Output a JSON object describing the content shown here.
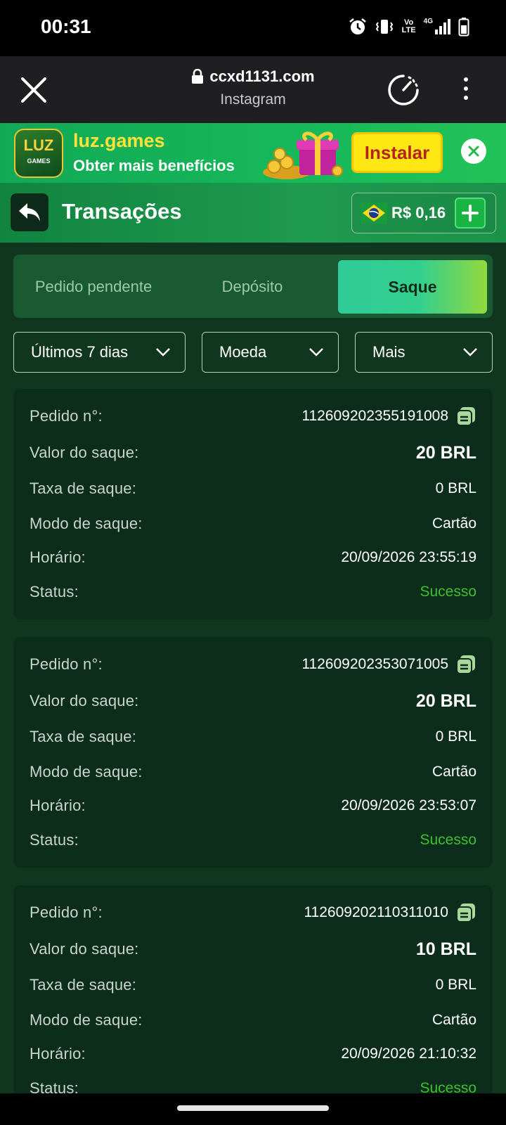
{
  "status_bar": {
    "time": "00:31",
    "network": "4G",
    "volte": "Vo LTE"
  },
  "browser": {
    "url": "ccxd1131.com",
    "source": "Instagram"
  },
  "ad": {
    "title": "luz.games",
    "subtitle": "Obter mais benefícios",
    "install_label": "Instalar",
    "logo_text": "LUZ",
    "logo_sub": "GAMES"
  },
  "header": {
    "title": "Transações",
    "balance": "R$ 0,16"
  },
  "tabs": [
    {
      "label": "Pedido pendente",
      "active": false
    },
    {
      "label": "Depósito",
      "active": false
    },
    {
      "label": "Saque",
      "active": true
    }
  ],
  "filters": [
    {
      "label": "Últimos 7 dias"
    },
    {
      "label": "Moeda"
    },
    {
      "label": "Mais"
    }
  ],
  "labels": {
    "order": "Pedido n°:",
    "amount": "Valor do saque:",
    "fee": "Taxa de saque:",
    "mode": "Modo de saque:",
    "time": "Horário:",
    "status": "Status:"
  },
  "transactions": [
    {
      "order_no": "112609202355191008",
      "amount": "20 BRL",
      "fee": "0 BRL",
      "mode": "Cartão",
      "time": "20/09/2026 23:55:19",
      "status": "Sucesso"
    },
    {
      "order_no": "112609202353071005",
      "amount": "20 BRL",
      "fee": "0 BRL",
      "mode": "Cartão",
      "time": "20/09/2026 23:53:07",
      "status": "Sucesso"
    },
    {
      "order_no": "112609202110311010",
      "amount": "10 BRL",
      "fee": "0 BRL",
      "mode": "Cartão",
      "time": "20/09/2026 21:10:32",
      "status": "Sucesso"
    }
  ],
  "colors": {
    "success": "#3fbf2d",
    "header_green": "#1e9a4f",
    "card_bg": "#0d2d1c",
    "accent_gradient_start": "#2fcb98",
    "accent_gradient_end": "#93d83d"
  }
}
